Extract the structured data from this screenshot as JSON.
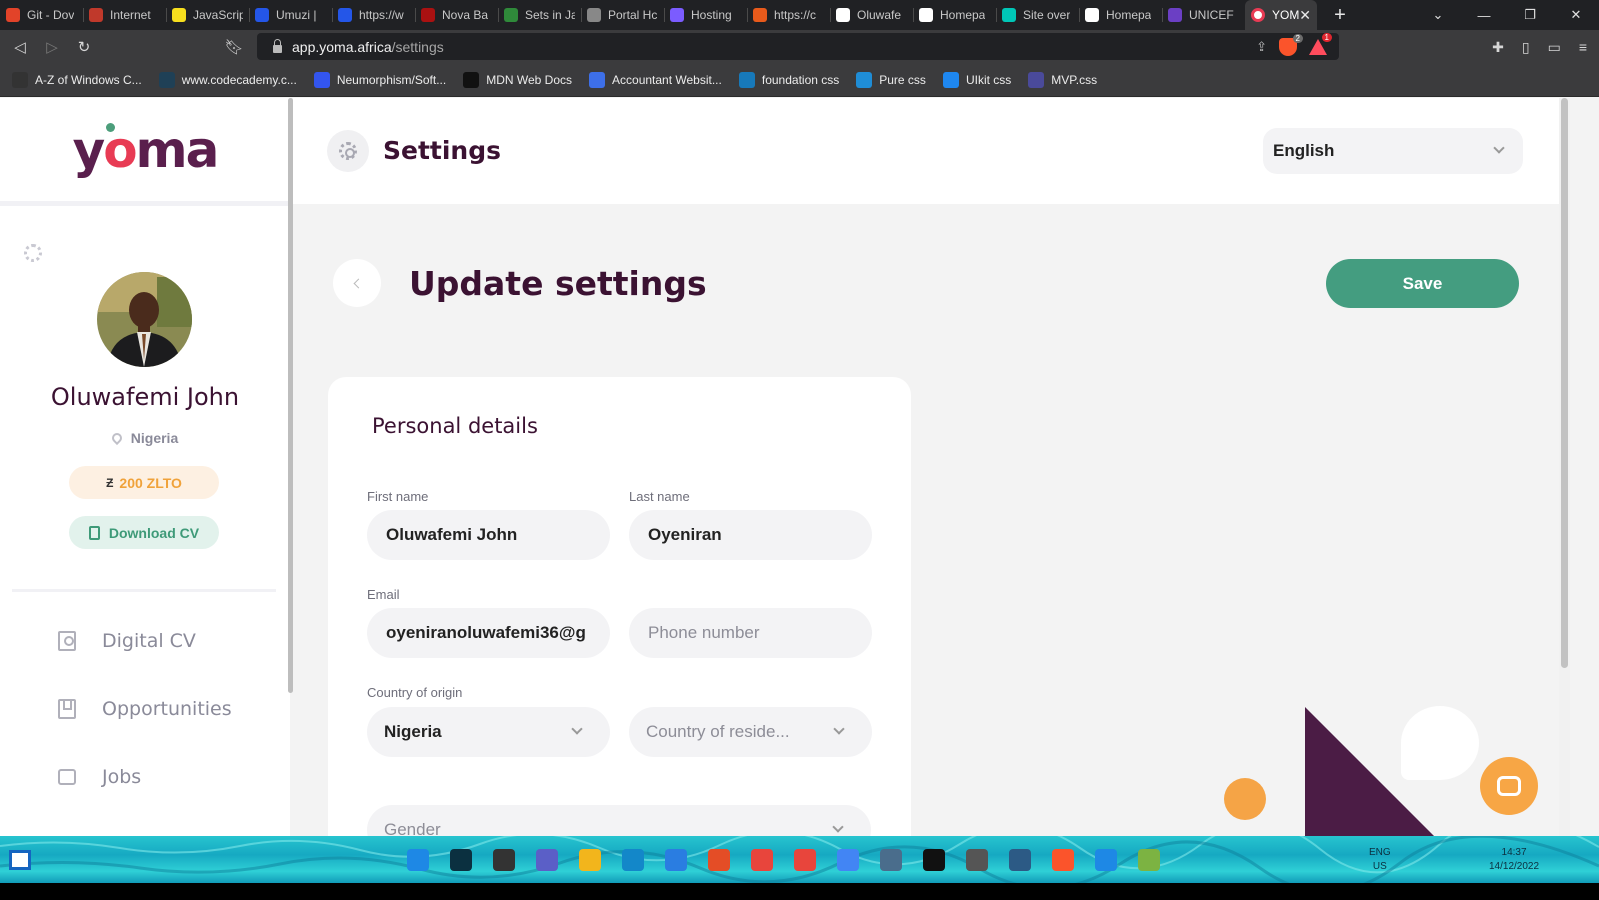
{
  "browser": {
    "tabs": [
      {
        "label": "Git - Dov",
        "fav": "#e24329"
      },
      {
        "label": "Internet",
        "fav": "#c0392b"
      },
      {
        "label": "JavaScrip",
        "fav": "#f7df1e"
      },
      {
        "label": "Umuzi |",
        "fav": "#2456e8"
      },
      {
        "label": "https://w",
        "fav": "#2456e8"
      },
      {
        "label": "Nova Ba",
        "fav": "#a11"
      },
      {
        "label": "Sets in Ja",
        "fav": "#2f8a3a"
      },
      {
        "label": "Portal Hc",
        "fav": "#888"
      },
      {
        "label": "Hosting",
        "fav": "#7b5cff"
      },
      {
        "label": "https://c",
        "fav": "#e85a1b"
      },
      {
        "label": "Oluwafe",
        "fav": "#fff"
      },
      {
        "label": "Homepa",
        "fav": "#fff"
      },
      {
        "label": "Site over",
        "fav": "#00c7b7"
      },
      {
        "label": "Homepa",
        "fav": "#fff"
      },
      {
        "label": "UNICEF",
        "fav": "#6b3fc4"
      }
    ],
    "active_tab": {
      "label": "YOM",
      "fav": "#e83b54"
    },
    "url_host": "app.yoma.africa",
    "url_path": "/settings",
    "brave_shields_count": "2",
    "rewards_count": "1",
    "bookmarks": [
      {
        "label": "A-Z of Windows C...",
        "color": "#333"
      },
      {
        "label": "www.codecademy.c...",
        "color": "#1f4056"
      },
      {
        "label": "Neumorphism/Soft...",
        "color": "#3355ee"
      },
      {
        "label": "MDN Web Docs",
        "color": "#111"
      },
      {
        "label": "Accountant Websit...",
        "color": "#3d6fe8"
      },
      {
        "label": "foundation css",
        "color": "#1779ba"
      },
      {
        "label": "Pure css",
        "color": "#1f8dd6"
      },
      {
        "label": "UIkit css",
        "color": "#1e87f0"
      },
      {
        "label": "MVP.css",
        "color": "#4a4a9a"
      }
    ]
  },
  "sidebar": {
    "logo": "yoma",
    "profile_name": "Oluwafemi John",
    "country": "Nigeria",
    "zlto": "200 ZLTO",
    "download_cv": "Download CV",
    "nav": [
      {
        "label": "Digital CV",
        "icon": "person-card-icon"
      },
      {
        "label": "Opportunities",
        "icon": "bookmark-icon"
      },
      {
        "label": "Jobs",
        "icon": "briefcase-icon"
      }
    ]
  },
  "header": {
    "title": "Settings",
    "language": "English"
  },
  "main": {
    "page_title": "Update settings",
    "save_label": "Save",
    "card_title": "Personal details",
    "fields": {
      "first_name_label": "First name",
      "first_name_value": "Oluwafemi John",
      "last_name_label": "Last name",
      "last_name_value": "Oyeniran",
      "email_label": "Email",
      "email_value": "oyeniranoluwafemi36@g",
      "phone_placeholder": "Phone number",
      "country_label": "Country of origin",
      "country_value": "Nigeria",
      "residence_placeholder": "Country of reside...",
      "gender_placeholder": "Gender"
    }
  },
  "taskbar": {
    "lang": "ENG",
    "region": "US",
    "time": "14:37",
    "date": "14/12/2022"
  },
  "colors": {
    "brand_purple": "#3b1232",
    "save_green": "#449d80",
    "zlto_orange": "#f0a23a",
    "chat_orange": "#f7a645"
  }
}
